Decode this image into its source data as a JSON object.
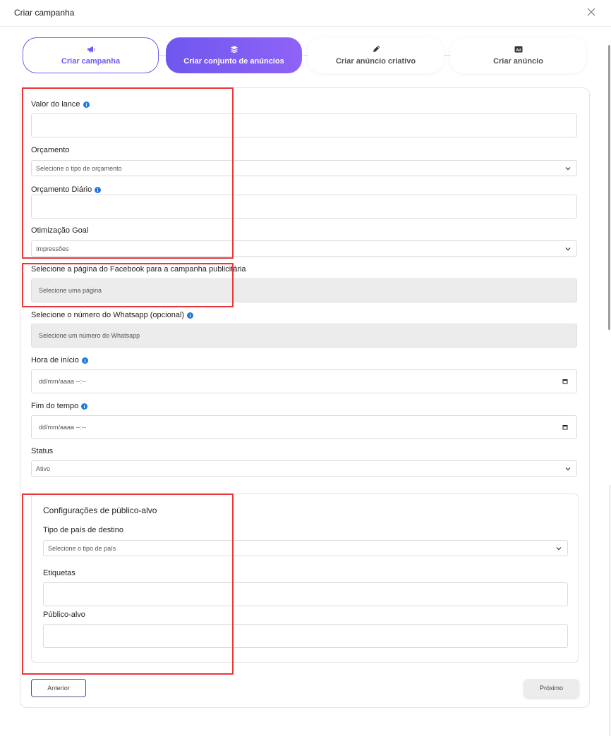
{
  "modal": {
    "title": "Criar campanha"
  },
  "stepper": {
    "steps": [
      {
        "label": "Criar campanha",
        "icon": "megaphone-icon",
        "state": "done"
      },
      {
        "label": "Criar conjunto de anúncios",
        "icon": "layers-icon",
        "state": "active"
      },
      {
        "label": "Criar anúncio criativo",
        "icon": "pen-icon",
        "state": "pending"
      },
      {
        "label": "Criar anúncio",
        "icon": "ad-icon",
        "state": "pending"
      }
    ]
  },
  "form": {
    "bid_value": {
      "label": "Valor do lance",
      "value": ""
    },
    "budget": {
      "label": "Orçamento",
      "selected": "Selecione o tipo de orçamento"
    },
    "daily_budget": {
      "label": "Orçamento Diário",
      "value": ""
    },
    "optimization_goal": {
      "label": "Otimização Goal",
      "selected": "Impressões"
    },
    "facebook_page": {
      "label": "Selecione a página do Facebook para a campanha publicitária",
      "selected": "Selecione uma página"
    },
    "whatsapp_number": {
      "label": "Selecione o número do Whatsapp (opcional)",
      "selected": "Selecione um número do Whatsapp"
    },
    "start_time": {
      "label": "Hora de início",
      "placeholder": "dd/mm/aaaa --:--"
    },
    "end_time": {
      "label": "Fim do tempo",
      "placeholder": "dd/mm/aaaa --:--"
    },
    "status": {
      "label": "Status",
      "selected": "Ativo"
    }
  },
  "audience": {
    "title": "Configurações de público-alvo",
    "country_type": {
      "label": "Tipo de país de destino",
      "selected": "Selecione o tipo de país"
    },
    "tags": {
      "label": "Etiquetas",
      "value": ""
    },
    "target_audience": {
      "label": "Público-alvo",
      "value": ""
    }
  },
  "footer": {
    "prev_label": "Anterior",
    "next_label": "Próximo"
  },
  "colors": {
    "accent": "#6d5cf0",
    "info": "#1f78e0",
    "highlight": "#e8363a"
  }
}
